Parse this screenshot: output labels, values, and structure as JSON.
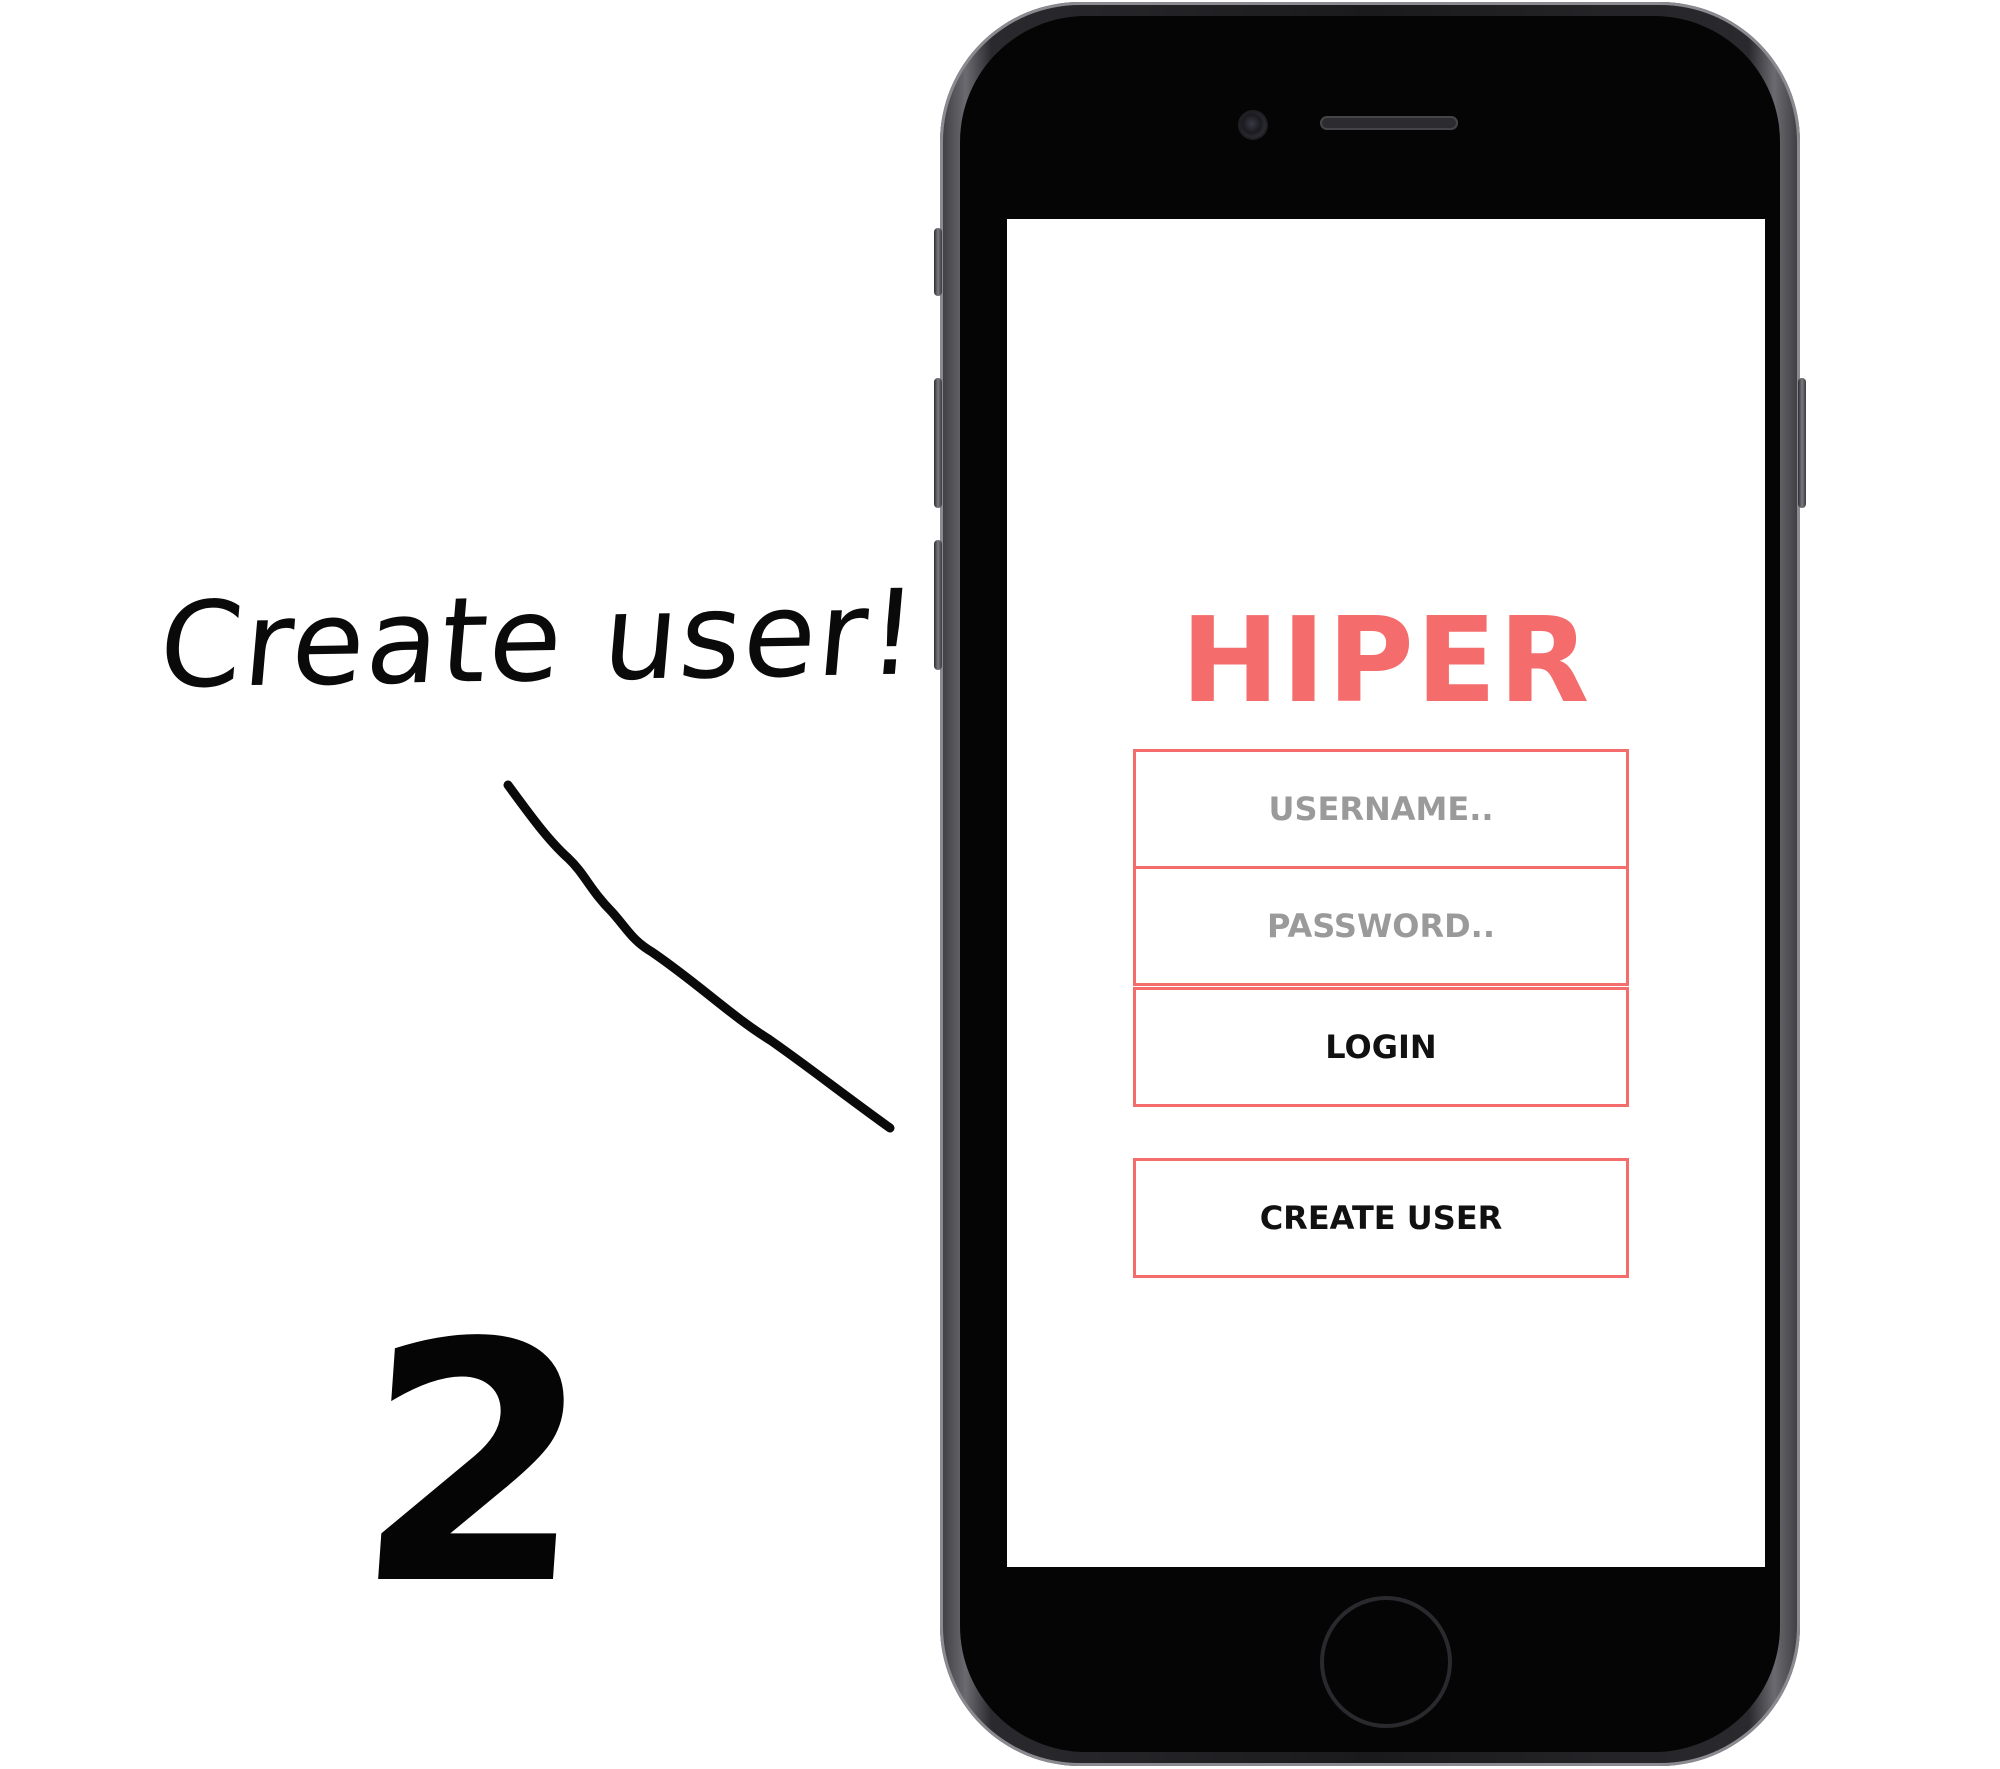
{
  "annotation": {
    "caption": "Create user!",
    "step_number": "2"
  },
  "app": {
    "title": "HIPER",
    "brand_color": "#f56c6c",
    "username": {
      "value": "",
      "placeholder": "USERNAME.."
    },
    "password": {
      "value": "",
      "placeholder": "PASSWORD.."
    },
    "login_label": "LOGIN",
    "create_user_label": "CREATE USER"
  },
  "icons": {
    "camera": "front-camera-icon",
    "speaker": "earpiece-speaker-icon",
    "home": "home-button-icon"
  }
}
